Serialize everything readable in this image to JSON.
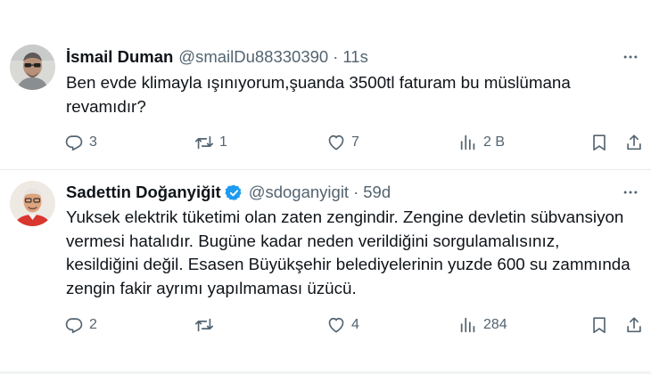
{
  "tweets": [
    {
      "author_name": "İsmail Duman",
      "handle": "@smailDu88330390",
      "separator": "·",
      "time": "11s",
      "verified": false,
      "text_lines": [
        "Ben evde klimayla ışınıyorum,şuanda 3500tl faturam bu müslümana",
        "revamıdır?"
      ],
      "stats": {
        "replies": "3",
        "reposts": "1",
        "likes": "7",
        "views": "2 B"
      }
    },
    {
      "author_name": "Sadettin Doğanyiğit",
      "handle": "@sdoganyigit",
      "separator": "·",
      "time": "59d",
      "verified": true,
      "text_lines": [
        "Yuksek elektrik tüketimi olan zaten zengindir. Zengine devletin sübvansiyon",
        "vermesi hatalıdır. Bugüne kadar neden verildiğini sorgulamalısınız,",
        "kesildiğini değil. Esasen Büyükşehir belediyelerinin yuzde 600 su zammında",
        "zengin fakir ayrımı yapılmaması üzücü."
      ],
      "stats": {
        "replies": "2",
        "reposts": "",
        "likes": "4",
        "views": "284"
      }
    }
  ],
  "icons": {
    "reply": "reply-icon",
    "repost": "repost-icon",
    "like": "like-icon",
    "views": "views-icon",
    "bookmark": "bookmark-icon",
    "share": "share-icon",
    "more": "more-icon",
    "verified": "verified-badge-icon"
  },
  "colors": {
    "text": "#0f1419",
    "secondary": "#536471",
    "verified": "#1d9bf0",
    "divider": "#e6ecf0"
  }
}
